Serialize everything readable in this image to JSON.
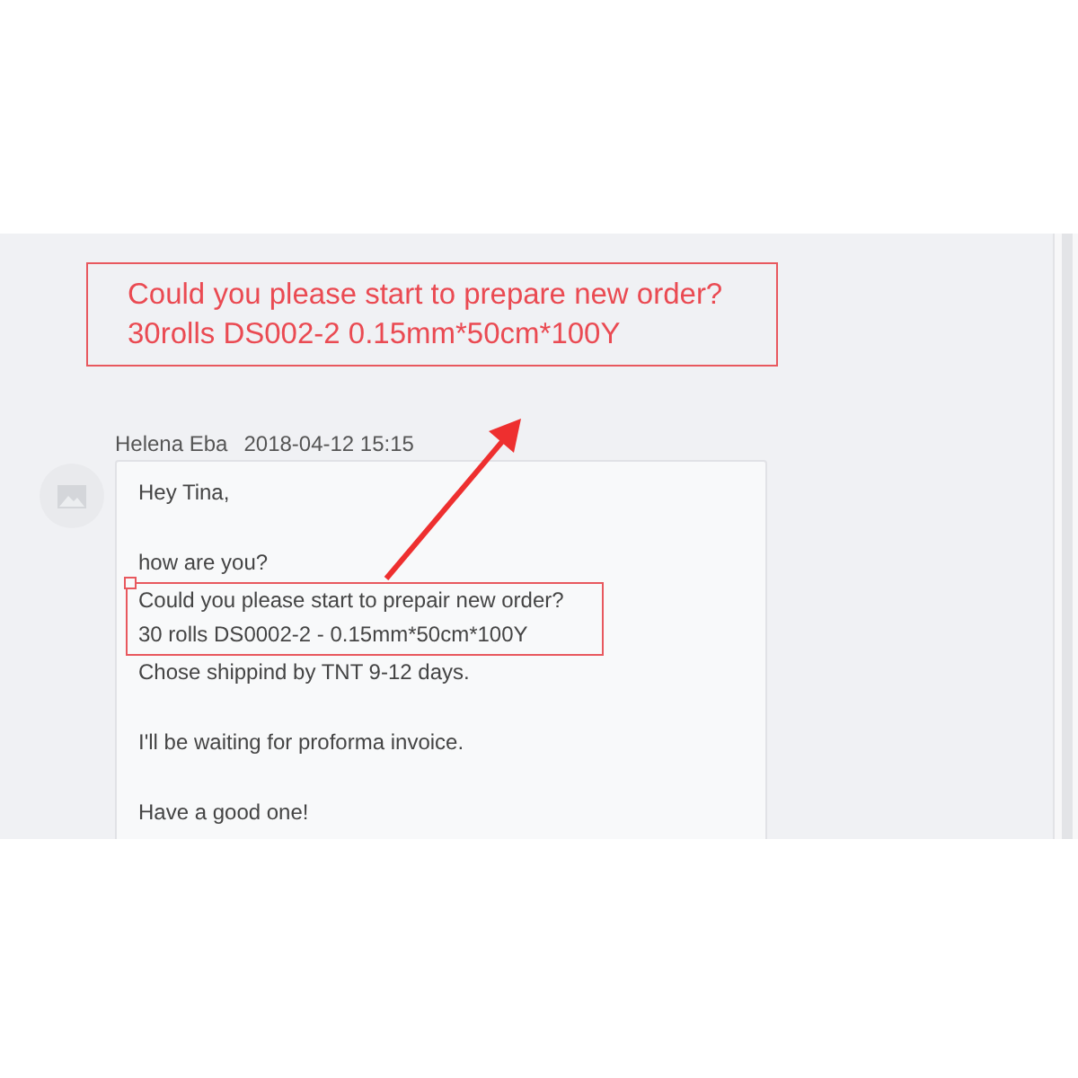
{
  "annotation": {
    "lines": [
      "Could you please start to prepare new order?",
      "30rolls DS002-2 0.15mm*50cm*100Y"
    ]
  },
  "message": {
    "sender": "Helena Eba",
    "time": "2018-04-12 15:15",
    "paragraphs": [
      {
        "lines": [
          {
            "text": "Hey Tina,",
            "highlighted": false
          }
        ]
      },
      {
        "lines": [
          {
            "text": "how are you?",
            "highlighted": false
          },
          {
            "text": "Could you please start to prepair new order?",
            "highlighted": true
          },
          {
            "text": "30 rolls DS0002-2 - 0.15mm*50cm*100Y",
            "highlighted": true
          },
          {
            "text": "Chose shippind by TNT 9-12 days.",
            "highlighted": false
          }
        ]
      },
      {
        "lines": [
          {
            "text": "I'll be waiting for proforma invoice.",
            "highlighted": false
          }
        ]
      },
      {
        "lines": [
          {
            "text": "Have a good one!",
            "highlighted": false
          }
        ]
      }
    ]
  }
}
